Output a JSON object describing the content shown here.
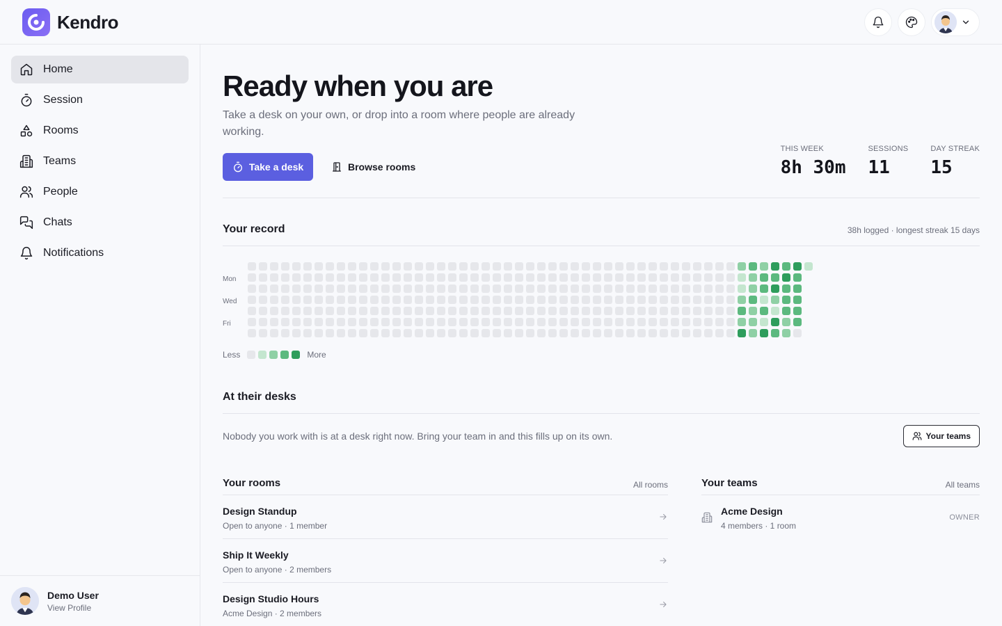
{
  "app": {
    "name": "Kendro",
    "logo_icon": "kendro-logo-icon"
  },
  "header": {
    "notifications_icon": "bell-icon",
    "theme_icon": "palette-icon",
    "user_menu_icon": "chevron-down-icon"
  },
  "sidebar": {
    "items": [
      {
        "label": "Home",
        "icon": "home-icon",
        "active": true
      },
      {
        "label": "Session",
        "icon": "timer-icon",
        "active": false
      },
      {
        "label": "Rooms",
        "icon": "shapes-icon",
        "active": false
      },
      {
        "label": "Teams",
        "icon": "building-icon",
        "active": false
      },
      {
        "label": "People",
        "icon": "users-icon",
        "active": false
      },
      {
        "label": "Chats",
        "icon": "chat-icon",
        "active": false
      },
      {
        "label": "Notifications",
        "icon": "bell-icon",
        "active": false
      }
    ],
    "profile": {
      "name": "Demo User",
      "link": "View Profile"
    }
  },
  "hero": {
    "title": "Ready when you are",
    "subtitle": "Take a desk on your own, or drop into a room where people are already working.",
    "primary_button": "Take a desk",
    "secondary_button": "Browse rooms"
  },
  "stats": [
    {
      "label": "THIS WEEK",
      "value": "8h 30m"
    },
    {
      "label": "SESSIONS",
      "value": "11"
    },
    {
      "label": "DAY STREAK",
      "value": "15"
    }
  ],
  "record": {
    "title": "Your record",
    "meta": "38h logged · longest streak 15 days",
    "day_labels": [
      "Mon",
      "Wed",
      "Fri"
    ],
    "legend_less": "Less",
    "legend_more": "More",
    "colors": [
      "#e6e7eb",
      "#c4e6cf",
      "#8fd0a5",
      "#5cb97f",
      "#2e9d5c"
    ]
  },
  "desks": {
    "title": "At their desks",
    "empty_text": "Nobody you work with is at a desk right now. Bring your team in and this fills up on its own.",
    "button": "Your teams"
  },
  "rooms": {
    "title": "Your rooms",
    "link": "All rooms",
    "items": [
      {
        "name": "Design Standup",
        "meta": "Open to anyone · 1 member"
      },
      {
        "name": "Ship It Weekly",
        "meta": "Open to anyone · 2 members"
      },
      {
        "name": "Design Studio Hours",
        "meta": "Acme Design · 2 members"
      }
    ]
  },
  "teams": {
    "title": "Your teams",
    "link": "All teams",
    "items": [
      {
        "name": "Acme Design",
        "meta": "4 members · 1 room",
        "role": "OWNER"
      }
    ]
  }
}
